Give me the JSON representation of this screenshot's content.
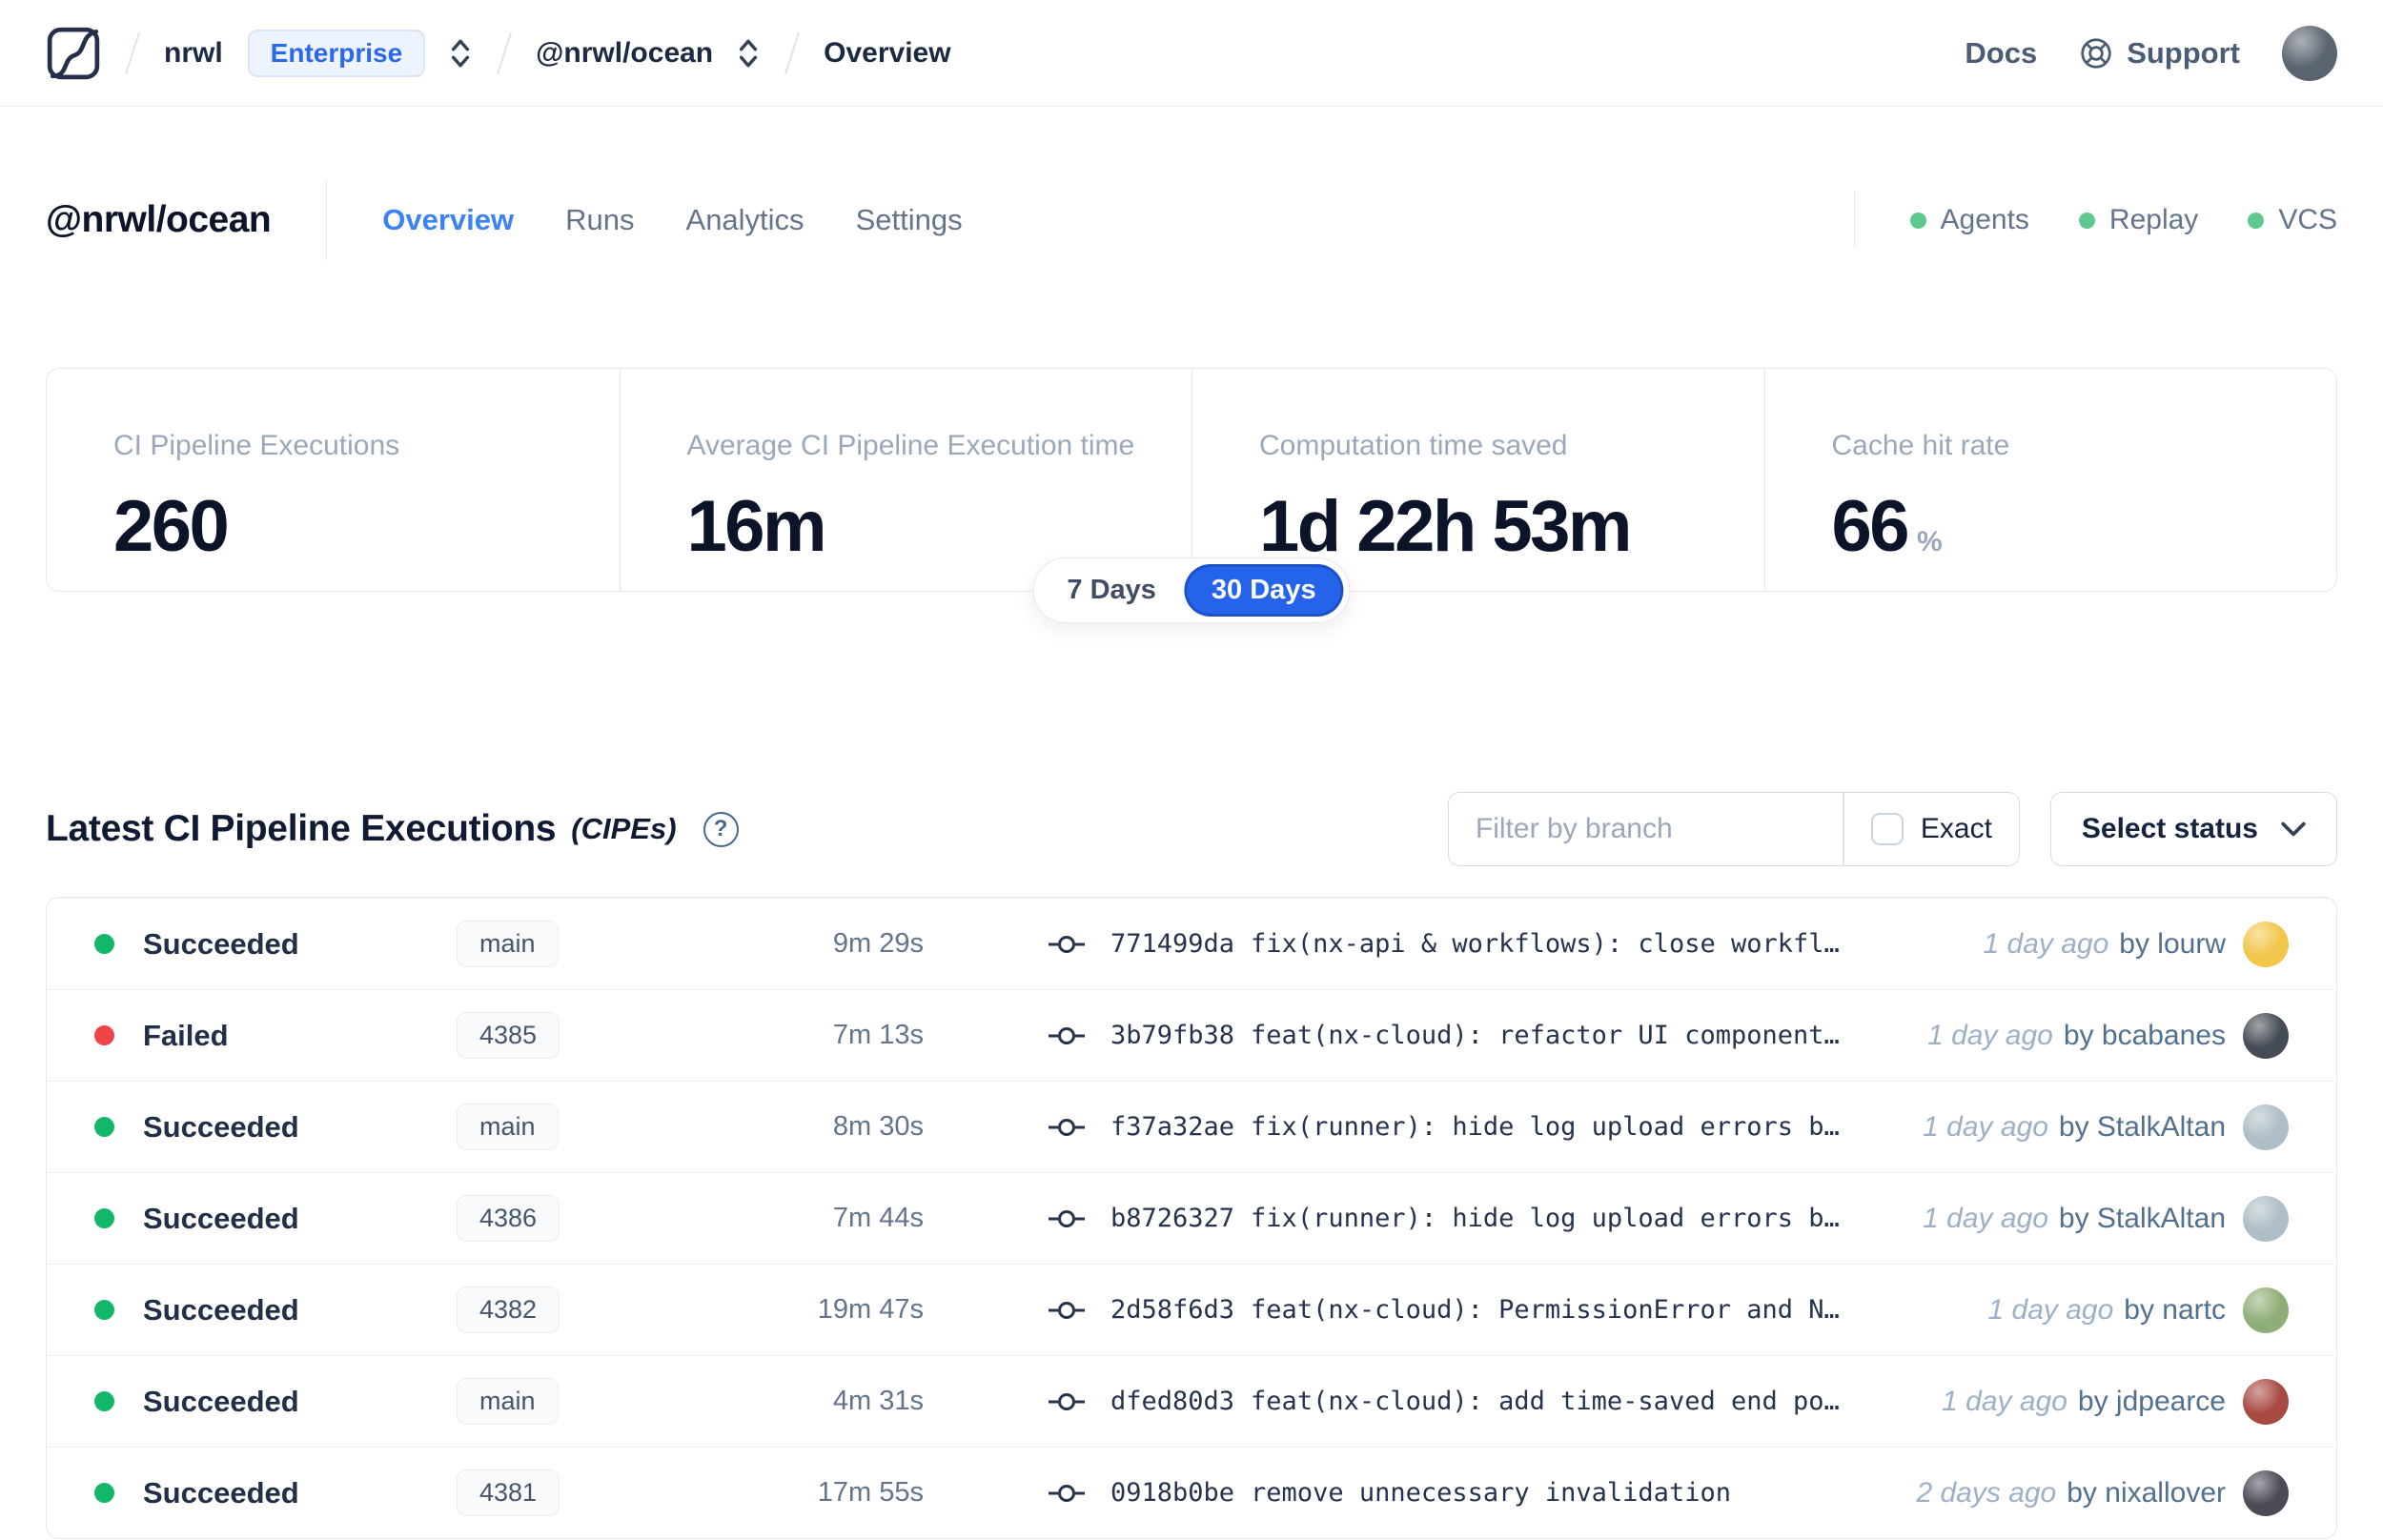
{
  "colors": {
    "accent_blue": "#2563eb",
    "active_tab_blue": "#3b82f6",
    "indicator_green": "#5ec98f",
    "success_green": "#12b76a",
    "failed_red": "#ef4444"
  },
  "nav": {
    "breadcrumb": {
      "org": "nrwl",
      "org_badge": "Enterprise",
      "workspace": "@nrwl/ocean",
      "page": "Overview"
    },
    "docs_label": "Docs",
    "support_label": "Support"
  },
  "workspace_header": {
    "title": "@nrwl/ocean",
    "tabs": [
      {
        "label": "Overview"
      },
      {
        "label": "Runs"
      },
      {
        "label": "Analytics"
      },
      {
        "label": "Settings"
      }
    ],
    "active_tab": "Overview",
    "indicators": [
      {
        "label": "Agents"
      },
      {
        "label": "Replay"
      },
      {
        "label": "VCS"
      }
    ]
  },
  "stats": [
    {
      "label": "CI Pipeline Executions",
      "value": "260",
      "suffix": ""
    },
    {
      "label": "Average CI Pipeline Execution time",
      "value": "16m",
      "suffix": ""
    },
    {
      "label": "Computation time saved",
      "value": "1d 22h 53m",
      "suffix": ""
    },
    {
      "label": "Cache hit rate",
      "value": "66",
      "suffix": "%"
    }
  ],
  "range_toggle": {
    "options": [
      "7 Days",
      "30 Days"
    ],
    "selected": "30 Days"
  },
  "cipe_section": {
    "title": "Latest CI Pipeline Executions",
    "title_suffix": "(CIPEs)",
    "filter_placeholder": "Filter by branch",
    "exact_label": "Exact",
    "status_select_label": "Select status",
    "rows": [
      {
        "status": "Succeeded",
        "status_color": "#12b76a",
        "branch": "main",
        "duration": "9m 29s",
        "commit_hash": "771499da",
        "commit_message": "fix(nx-api & workflows): close workfl…",
        "time_ago": "1 day ago",
        "author_line": "by lourw",
        "avatar_color": "#f2c64a"
      },
      {
        "status": "Failed",
        "status_color": "#ef4444",
        "branch": "4385",
        "duration": "7m 13s",
        "commit_hash": "3b79fb38",
        "commit_message": "feat(nx-cloud): refactor UI component…",
        "time_ago": "1 day ago",
        "author_line": "by bcabanes",
        "avatar_color": "#454c55"
      },
      {
        "status": "Succeeded",
        "status_color": "#12b76a",
        "branch": "main",
        "duration": "8m 30s",
        "commit_hash": "f37a32ae",
        "commit_message": "fix(runner): hide log upload errors b…",
        "time_ago": "1 day ago",
        "author_line": "by StalkAltan",
        "avatar_color": "#aebdc6"
      },
      {
        "status": "Succeeded",
        "status_color": "#12b76a",
        "branch": "4386",
        "duration": "7m 44s",
        "commit_hash": "b8726327",
        "commit_message": "fix(runner): hide log upload errors b…",
        "time_ago": "1 day ago",
        "author_line": "by StalkAltan",
        "avatar_color": "#aebdc6"
      },
      {
        "status": "Succeeded",
        "status_color": "#12b76a",
        "branch": "4382",
        "duration": "19m 47s",
        "commit_hash": "2d58f6d3",
        "commit_message": "feat(nx-cloud): PermissionError and N…",
        "time_ago": "1 day ago",
        "author_line": "by nartc",
        "avatar_color": "#8fae77"
      },
      {
        "status": "Succeeded",
        "status_color": "#12b76a",
        "branch": "main",
        "duration": "4m 31s",
        "commit_hash": "dfed80d3",
        "commit_message": "feat(nx-cloud): add time-saved end po…",
        "time_ago": "1 day ago",
        "author_line": "by jdpearce",
        "avatar_color": "#a84a42"
      },
      {
        "status": "Succeeded",
        "status_color": "#12b76a",
        "branch": "4381",
        "duration": "17m 55s",
        "commit_hash": "0918b0be",
        "commit_message": "remove unnecessary invalidation",
        "time_ago": "2 days ago",
        "author_line": "by nixallover",
        "avatar_color": "#4e4a55"
      }
    ]
  }
}
